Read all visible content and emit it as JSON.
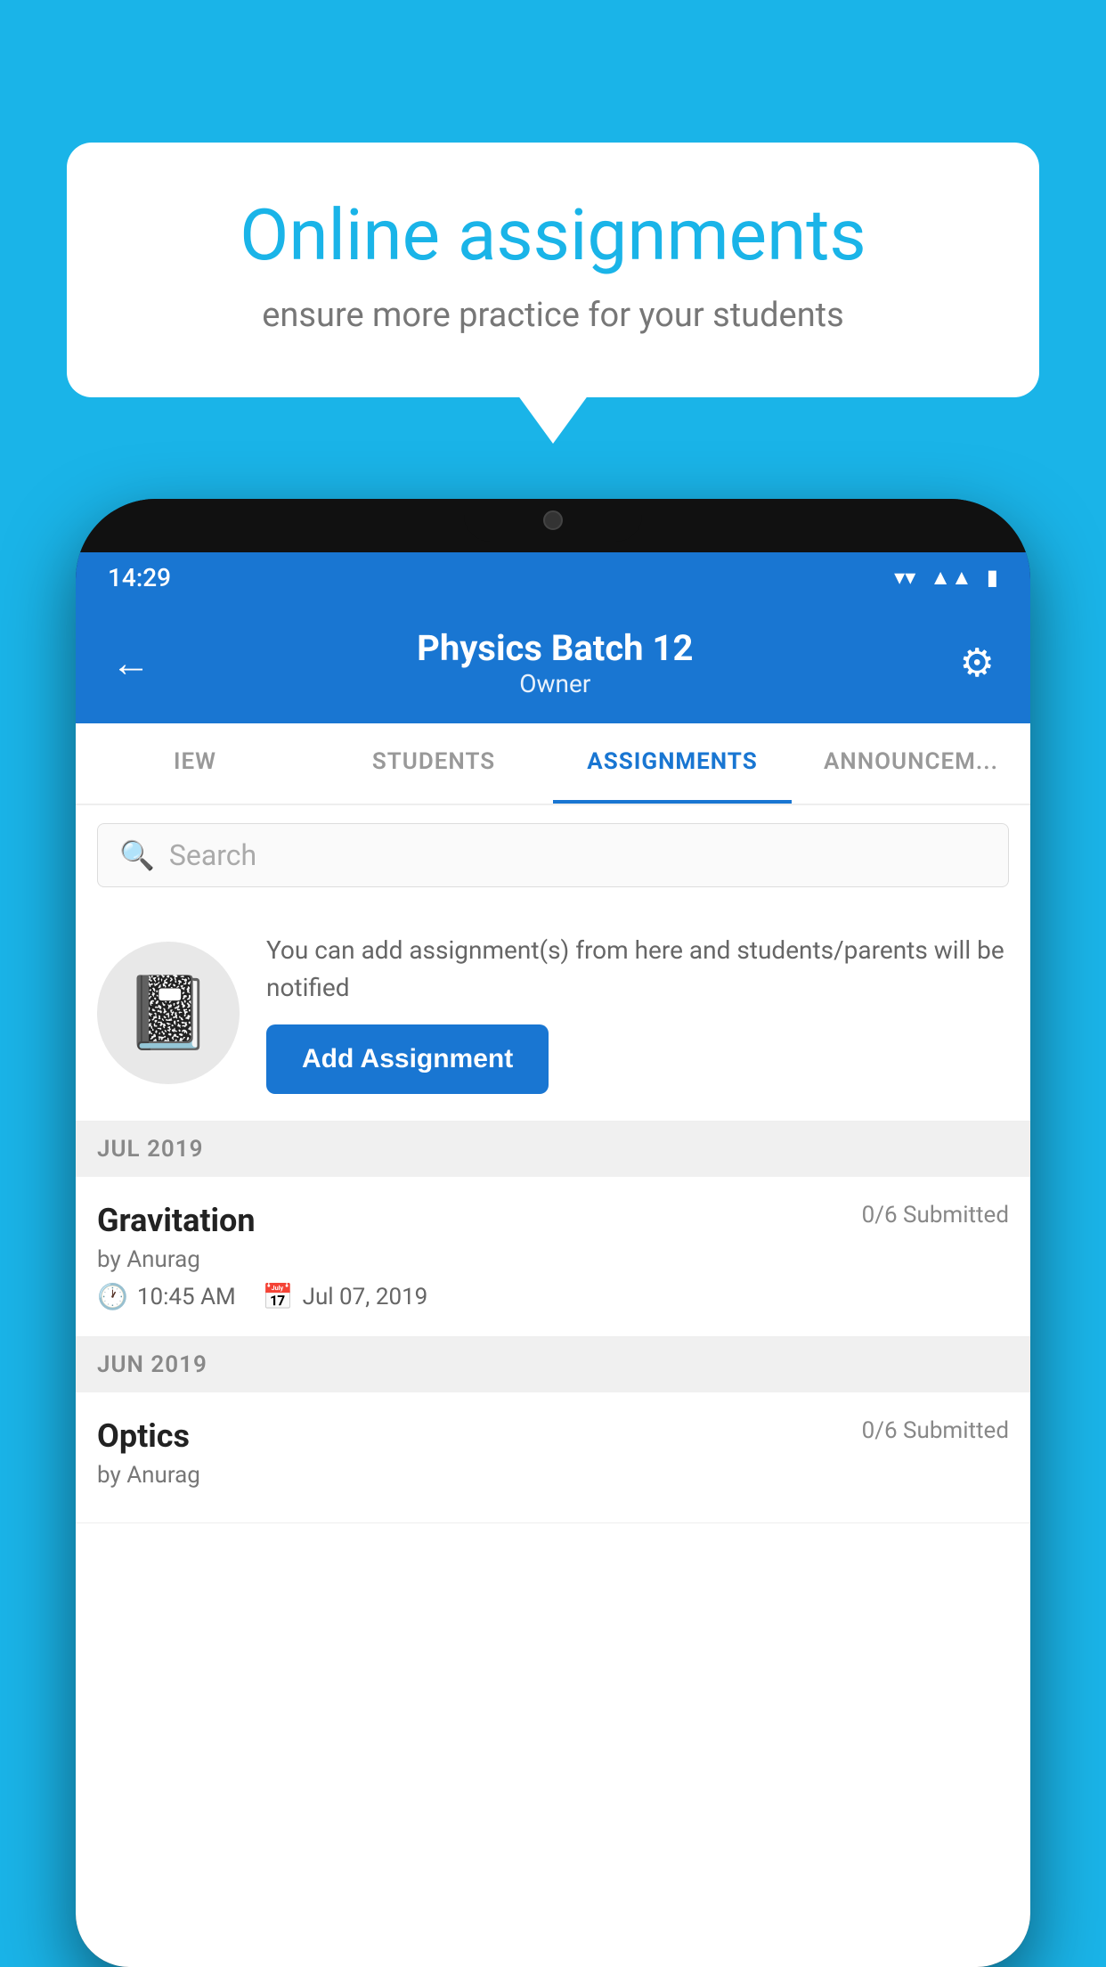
{
  "background_color": "#1ab4e8",
  "speech_bubble": {
    "title": "Online assignments",
    "subtitle": "ensure more practice for your students"
  },
  "phone": {
    "status_bar": {
      "time": "14:29",
      "icons": [
        "wifi",
        "signal",
        "battery"
      ]
    },
    "header": {
      "title": "Physics Batch 12",
      "subtitle": "Owner",
      "back_label": "←",
      "settings_label": "⚙"
    },
    "tabs": [
      {
        "label": "IEW",
        "active": false
      },
      {
        "label": "STUDENTS",
        "active": false
      },
      {
        "label": "ASSIGNMENTS",
        "active": true
      },
      {
        "label": "ANNOUNCEM...",
        "active": false
      }
    ],
    "search": {
      "placeholder": "Search"
    },
    "promo": {
      "text": "You can add assignment(s) from here and students/parents will be notified",
      "button_label": "Add Assignment"
    },
    "sections": [
      {
        "label": "JUL 2019",
        "assignments": [
          {
            "title": "Gravitation",
            "submitted": "0/6 Submitted",
            "author": "by Anurag",
            "time": "10:45 AM",
            "date": "Jul 07, 2019"
          }
        ]
      },
      {
        "label": "JUN 2019",
        "assignments": [
          {
            "title": "Optics",
            "submitted": "0/6 Submitted",
            "author": "by Anurag",
            "time": "",
            "date": ""
          }
        ]
      }
    ]
  }
}
